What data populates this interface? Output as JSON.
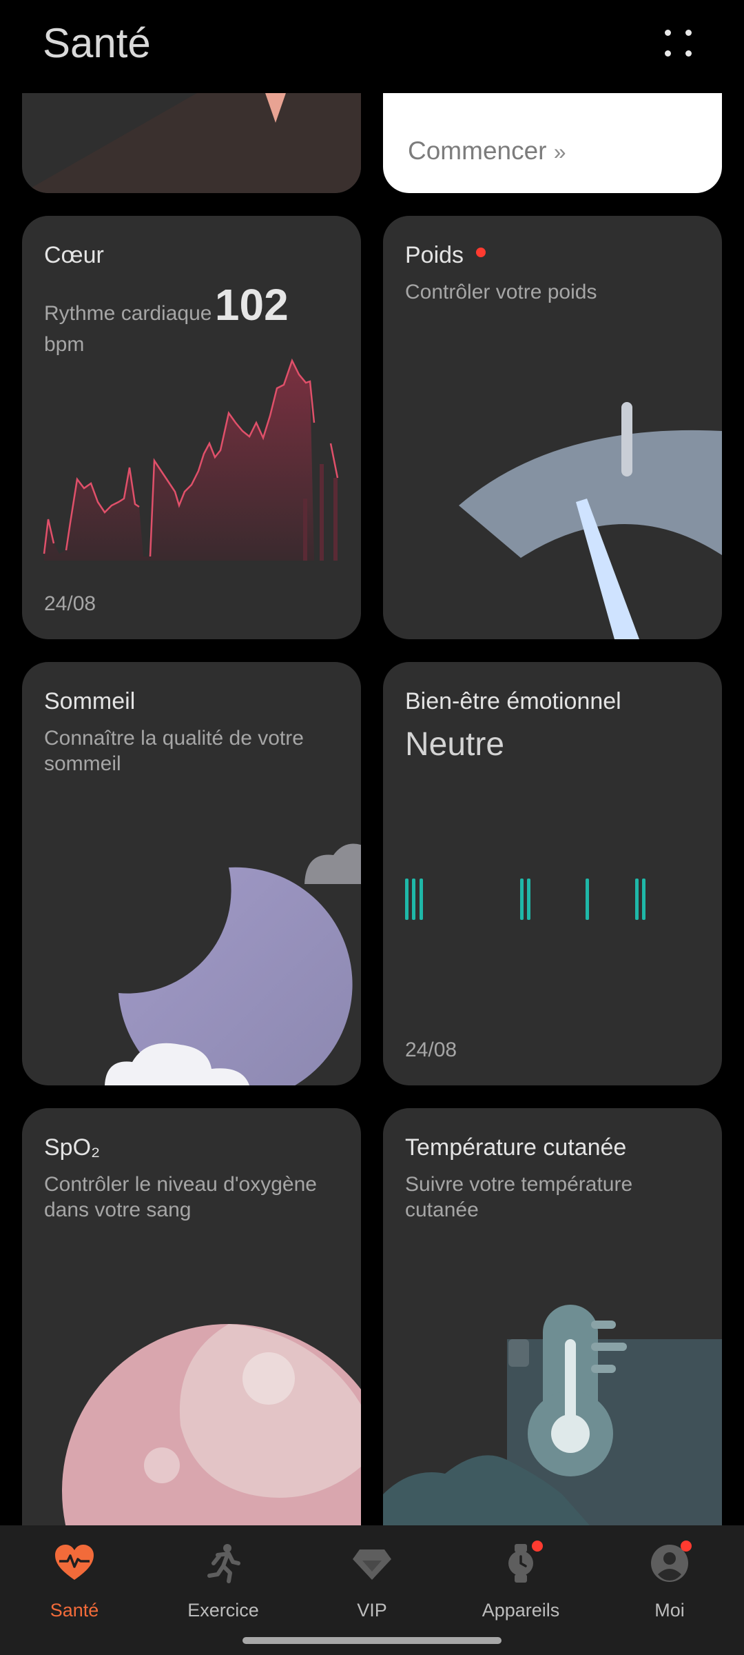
{
  "header": {
    "title": "Santé",
    "menu_icon": "more-dots-icon"
  },
  "promo_card": {
    "cta_label": "Commencer",
    "cta_icon": "double-chevron-right-icon"
  },
  "cards": {
    "heart": {
      "title": "Cœur",
      "metric_label": "Rythme cardiaque",
      "value": "102",
      "unit": "bpm",
      "date": "24/08"
    },
    "weight": {
      "title": "Poids",
      "subtitle": "Contrôler votre poids"
    },
    "sleep": {
      "title": "Sommeil",
      "subtitle": "Connaître la qualité de votre sommeil"
    },
    "emotion": {
      "title": "Bien-être émotionnel",
      "state": "Neutre",
      "date": "24/08"
    },
    "spo2": {
      "title": "SpO₂",
      "subtitle": "Contrôler le niveau d'oxygène dans votre sang"
    },
    "temperature": {
      "title": "Température cutanée",
      "subtitle": "Suivre votre température cutanée"
    }
  },
  "bottom_nav": {
    "items": [
      {
        "label": "Santé",
        "icon": "heart-pulse-icon",
        "active": true
      },
      {
        "label": "Exercice",
        "icon": "running-icon"
      },
      {
        "label": "VIP",
        "icon": "diamond-icon"
      },
      {
        "label": "Appareils",
        "icon": "watch-icon",
        "badge": true
      },
      {
        "label": "Moi",
        "icon": "profile-icon",
        "badge": true
      }
    ]
  },
  "colors": {
    "accent": "#f26b3a",
    "heart_line": "#e0506a",
    "emotion_bars": "#1fb8a8",
    "badge": "#ff3b30"
  }
}
